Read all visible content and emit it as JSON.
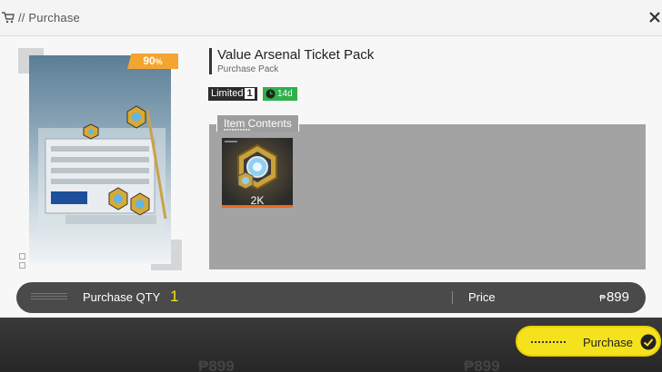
{
  "header": {
    "title": "// Purchase"
  },
  "product": {
    "discount_value": "90",
    "discount_unit": "%",
    "title": "Value Arsenal Ticket Pack",
    "subtitle": "Purchase Pack",
    "limited_label": "Limited",
    "limited_count": "1",
    "time_left": "14d"
  },
  "contents": {
    "label": "Item Contents",
    "items": [
      {
        "icon": "arsenal-ticket-icon",
        "quantity": "2K"
      }
    ]
  },
  "purchase_bar": {
    "qty_label": "Purchase QTY",
    "qty_value": "1",
    "price_label": "Price",
    "currency": "₱",
    "price_value": "899"
  },
  "footer": {
    "purchase_label": "Purchase",
    "ghost_price_left": "₱899",
    "ghost_price_right": "₱899"
  },
  "colors": {
    "accent_yellow": "#f4e21c",
    "discount_orange": "#f4a430",
    "timer_green": "#2fb04a"
  }
}
